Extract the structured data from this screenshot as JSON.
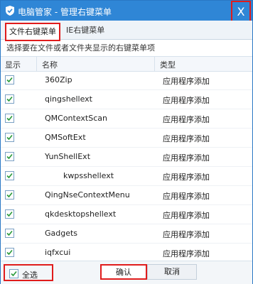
{
  "window": {
    "title": "电脑管家 - 管理右键菜单",
    "close_glyph": "X",
    "accent": "#2f86d6",
    "highlight": "#e01c1c"
  },
  "tabs": [
    {
      "label": "文件右键菜单",
      "active": true
    },
    {
      "label": "IE右键菜单",
      "active": false
    }
  ],
  "description": "选择要在文件或者文件夹显示的右键菜单项",
  "table": {
    "headers": {
      "show": "显示",
      "name": "名称",
      "type": "类型"
    },
    "rows": [
      {
        "checked": true,
        "name": "360Zip",
        "type": "应用程序添加",
        "indent": false
      },
      {
        "checked": true,
        "name": "qingshellext",
        "type": "应用程序添加",
        "indent": false
      },
      {
        "checked": true,
        "name": "QMContextScan",
        "type": "应用程序添加",
        "indent": false
      },
      {
        "checked": true,
        "name": "QMSoftExt",
        "type": "应用程序添加",
        "indent": false
      },
      {
        "checked": true,
        "name": "YunShellExt",
        "type": "应用程序添加",
        "indent": false
      },
      {
        "checked": true,
        "name": "kwpsshellext",
        "type": "应用程序添加",
        "indent": true
      },
      {
        "checked": true,
        "name": "QingNseContextMenu",
        "type": "应用程序添加",
        "indent": false
      },
      {
        "checked": true,
        "name": "qkdesktopshellext",
        "type": "应用程序添加",
        "indent": false
      },
      {
        "checked": true,
        "name": "Gadgets",
        "type": "应用程序添加",
        "indent": false
      },
      {
        "checked": true,
        "name": "iqfxcui",
        "type": "应用程序添加",
        "indent": false
      },
      {
        "checked": true,
        "name": "",
        "type": "",
        "indent": false
      }
    ]
  },
  "footer": {
    "select_all_label": "全选",
    "select_all_checked": true,
    "ok_label": "确认",
    "cancel_label": "取消"
  }
}
